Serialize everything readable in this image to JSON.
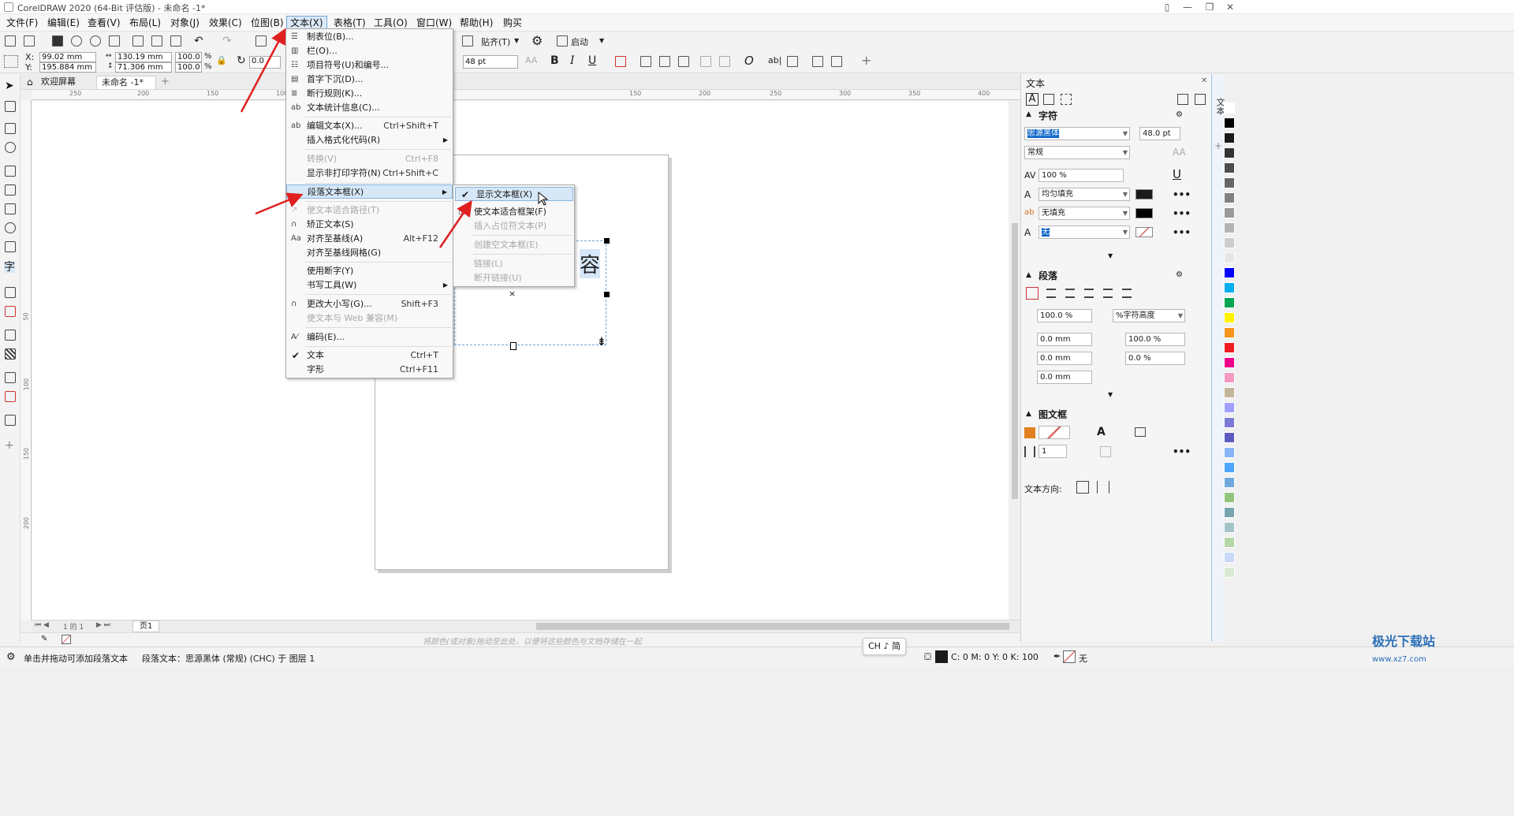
{
  "window": {
    "title": "CorelDRAW 2020 (64-Bit 评估版) - 未命名 -1*"
  },
  "menubar": {
    "items": [
      {
        "label": "文件(F)",
        "left": 0
      },
      {
        "label": "编辑(E)"
      },
      {
        "label": "查看(V)"
      },
      {
        "label": "布局(L)"
      },
      {
        "label": "对象(J)"
      },
      {
        "label": "效果(C)"
      },
      {
        "label": "位图(B)"
      },
      {
        "label": "文本(X)"
      },
      {
        "label": "表格(T)"
      },
      {
        "label": "工具(O)"
      },
      {
        "label": "窗口(W)"
      },
      {
        "label": "帮助(H)"
      },
      {
        "label": "购买"
      }
    ]
  },
  "toolbar": {
    "snap_label": "贴齐(T)",
    "launch_label": "启动"
  },
  "propbar": {
    "x_label": "X:",
    "x_value": "99.02 mm",
    "y_label": "Y:",
    "y_value": "195.884 mm",
    "w_value": "130.19 mm",
    "h_value": "71.306 mm",
    "sx_value": "100.0",
    "sy_value": "100.0",
    "pct": "%",
    "angle_value": "0.0",
    "font_size": "48 pt",
    "bold": "B",
    "italic": "I",
    "underline": "U",
    "ab_label": "ab|"
  },
  "doctabs": {
    "welcome": "欢迎屏幕",
    "doc": "未命名 -1*",
    "add": "+"
  },
  "rulers": {
    "h_ticks": [
      "250",
      "200",
      "150",
      "100",
      "150",
      "200",
      "250",
      "300",
      "350",
      "400"
    ],
    "v_ticks": [
      "50",
      "100",
      "150",
      "200"
    ]
  },
  "text_menu": {
    "items": [
      {
        "label": "制表位(B)...",
        "shortcut": "",
        "icon": "tab-icon"
      },
      {
        "label": "栏(O)...",
        "shortcut": "",
        "icon": "columns-icon"
      },
      {
        "label": "项目符号(U)和编号...",
        "shortcut": "",
        "icon": "bullets-icon"
      },
      {
        "label": "首字下沉(D)...",
        "shortcut": "",
        "icon": "dropcap-icon"
      },
      {
        "label": "断行规则(K)...",
        "shortcut": "",
        "icon": "linebreak-icon"
      },
      {
        "label": "文本统计信息(C)...",
        "shortcut": "",
        "icon": "stats-icon"
      },
      {
        "label": "编辑文本(X)...",
        "shortcut": "Ctrl+Shift+T",
        "icon": "edit-text-icon"
      },
      {
        "label": "插入格式化代码(R)",
        "shortcut": "",
        "icon": ""
      },
      {
        "label": "转换(V)",
        "shortcut": "Ctrl+F8",
        "icon": ""
      },
      {
        "label": "显示非打印字符(N)",
        "shortcut": "Ctrl+Shift+C",
        "icon": ""
      },
      {
        "label": "段落文本框(X)",
        "shortcut": "",
        "icon": ""
      },
      {
        "label": "使文本适合路径(T)",
        "shortcut": "",
        "icon": "fit-path-icon"
      },
      {
        "label": "矫正文本(S)",
        "shortcut": "",
        "icon": "straighten-icon"
      },
      {
        "label": "对齐至基线(A)",
        "shortcut": "Alt+F12",
        "icon": "baseline-icon"
      },
      {
        "label": "对齐至基线网格(G)",
        "shortcut": "",
        "icon": ""
      },
      {
        "label": "使用断字(Y)",
        "shortcut": "",
        "icon": ""
      },
      {
        "label": "书写工具(W)",
        "shortcut": "",
        "icon": ""
      },
      {
        "label": "更改大小写(G)...",
        "shortcut": "Shift+F3",
        "icon": "case-icon"
      },
      {
        "label": "使文本与 Web 兼容(M)",
        "shortcut": "",
        "icon": ""
      },
      {
        "label": "编码(E)...",
        "shortcut": "",
        "icon": "encoding-icon"
      },
      {
        "label": "文本",
        "shortcut": "Ctrl+T",
        "icon": ""
      },
      {
        "label": "字形",
        "shortcut": "Ctrl+F11",
        "icon": ""
      }
    ]
  },
  "sub_menu": {
    "items": [
      {
        "label": "显示文本框(X)"
      },
      {
        "label": "使文本适合框架(F)"
      },
      {
        "label": "插入占位符文本(P)"
      },
      {
        "label": "创建空文本框(E)"
      },
      {
        "label": "链接(L)"
      },
      {
        "label": "断开链接(U)"
      }
    ]
  },
  "canvas": {
    "char": "容",
    "x_mark": "×"
  },
  "pagebar": {
    "counter": "1 的 1",
    "page_tab": "页1"
  },
  "colorwell": {
    "hint": "将颜色(或对象)拖动至此处，以便将这些颜色与文档存储在一起"
  },
  "statusbar": {
    "hint": "单击并拖动可添加段落文本",
    "info": "段落文本：思源黑体 (常规) (CHC) 于 图层 1",
    "ime": "CH ♪ 简",
    "cmyk": "C: 0 M: 0 Y: 0 K: 100",
    "outline": "无"
  },
  "docker": {
    "title": "文本",
    "char_section": "字符",
    "font_name": "思源黑体",
    "font_size": "48.0 pt",
    "font_style": "常规",
    "scale": "100 %",
    "fill_type": "均匀填充",
    "bg_fill_type": "无填充",
    "outline_value": "无",
    "para_section": "段落",
    "line_spacing": "100.0 %",
    "spacing_unit": "%字符高度",
    "indent1": "0.0 mm",
    "indent2": "0.0 mm",
    "indent3": "0.0 mm",
    "before": "100.0 %",
    "after": "0.0 %",
    "frame_section": "图文框",
    "columns": "1",
    "direction_label": "文本方向:"
  },
  "colors": {
    "accent": "#86b5e0",
    "palette": [
      "#ffffff",
      "#000000",
      "#1a1a1a",
      "#333333",
      "#4d4d4d",
      "#666666",
      "#808080",
      "#999999",
      "#b3b3b3",
      "#cccccc",
      "#e6e6e6",
      "#0000ff",
      "#00aeef",
      "#00a651",
      "#fff200",
      "#f7941d",
      "#ed1c24",
      "#ec008c",
      "#f49ac1",
      "#c2b59b",
      "#a0a0ff",
      "#7b7bd6",
      "#5c5cc0",
      "#8ab4f8",
      "#4da6ff",
      "#6fa8dc",
      "#93c47d",
      "#76a5af",
      "#a2c4c9",
      "#b6d7a8",
      "#c9daf8",
      "#d9ead3"
    ]
  }
}
